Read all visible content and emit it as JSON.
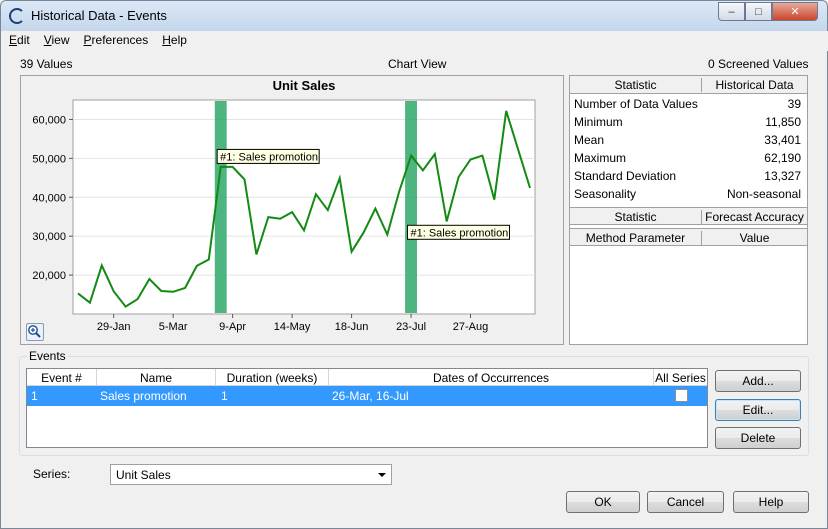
{
  "window": {
    "title": "Historical Data - Events",
    "min_label": "–",
    "max_label": "□",
    "close_label": "✕"
  },
  "menu": [
    {
      "key": "E",
      "rest": "dit"
    },
    {
      "key": "V",
      "rest": "iew"
    },
    {
      "key": "P",
      "rest": "references"
    },
    {
      "key": "H",
      "rest": "elp"
    }
  ],
  "info": {
    "values_count": "39 Values",
    "view_name": "Chart View",
    "screened": "0 Screened Values"
  },
  "chart_data": {
    "type": "line",
    "title": "Unit Sales",
    "y_ticks": [
      "20,000",
      "30,000",
      "40,000",
      "50,000",
      "60,000"
    ],
    "y_tick_values": [
      20000,
      30000,
      40000,
      50000,
      60000
    ],
    "ylim": [
      10000,
      65000
    ],
    "x_ticks": [
      "29-Jan",
      "5-Mar",
      "9-Apr",
      "14-May",
      "18-Jun",
      "23-Jul",
      "27-Aug"
    ],
    "series": [
      {
        "values": [
          15300,
          12900,
          22500,
          15800,
          11900,
          13800,
          19000,
          15900,
          15700,
          16700,
          22400,
          24000,
          47800,
          47800,
          44600,
          25300,
          34900,
          34500,
          36200,
          31500,
          40800,
          36700,
          44900,
          26000,
          30900,
          37100,
          30400,
          41500,
          50700,
          46900,
          51100,
          33800,
          45200,
          49700,
          50700,
          39400,
          62200,
          52300,
          42400
        ]
      }
    ],
    "line_color": "#138a13",
    "events": [
      {
        "label": "#1: Sales promotion",
        "index": 12,
        "label_value": 50500
      },
      {
        "label": "#1: Sales promotion",
        "index": 28,
        "label_value": 31000
      }
    ],
    "event_band_color": "#2fa86a",
    "zoom_icon": "zoom-in-icon"
  },
  "stats": {
    "header": {
      "col1": "Statistic",
      "col2": "Historical Data"
    },
    "rows": [
      {
        "label": "Number of Data Values",
        "value": "39"
      },
      {
        "label": "Minimum",
        "value": "11,850"
      },
      {
        "label": "Mean",
        "value": "33,401"
      },
      {
        "label": "Maximum",
        "value": "62,190"
      },
      {
        "label": "Standard Deviation",
        "value": "13,327"
      },
      {
        "label": "Seasonality",
        "value": "Non-seasonal"
      }
    ],
    "header2": {
      "col1": "Statistic",
      "col2": "Forecast Accuracy"
    },
    "header3": {
      "col1": "Method Parameter",
      "col2": "Value"
    }
  },
  "events": {
    "group_label": "Events",
    "columns": [
      "Event #",
      "Name",
      "Duration (weeks)",
      "Dates of Occurrences",
      "All Series"
    ],
    "rows": [
      {
        "num": "1",
        "name": "Sales promotion",
        "duration": "1",
        "dates": "26-Mar, 16-Jul",
        "all_series": false
      }
    ],
    "add_label": "Add...",
    "edit_label": "Edit...",
    "delete_label": "Delete"
  },
  "series": {
    "label": "Series:",
    "value": "Unit Sales"
  },
  "footer": {
    "ok": "OK",
    "cancel": "Cancel",
    "help": "Help"
  }
}
